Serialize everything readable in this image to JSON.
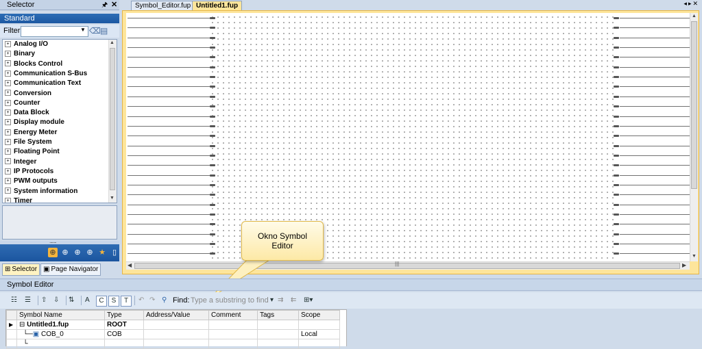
{
  "selector": {
    "title": "Selector",
    "category": "Standard",
    "filter_label": "Filter",
    "filter_value": "",
    "tree_items": [
      "Analog I/O",
      "Binary",
      "Blocks Control",
      "Communication S-Bus",
      "Communication Text",
      "Conversion",
      "Counter",
      "Data Block",
      "Display module",
      "Energy Meter",
      "File System",
      "Floating Point",
      "Integer",
      "IP Protocols",
      "PWM outputs",
      "System information",
      "Timer"
    ],
    "bottom_tabs": [
      "Selector",
      "Page Navigator"
    ]
  },
  "doc_tabs": [
    "Symbol_Editor.fup",
    "Untitled1.fup"
  ],
  "callout": {
    "line1": "Okno Symbol",
    "line2": "Editor"
  },
  "symbol_editor": {
    "title": "Symbol Editor",
    "toolbar_letters": [
      "A",
      "C",
      "S",
      "T"
    ],
    "find_label": "Find:",
    "find_placeholder": "Type a substring to find",
    "columns": [
      "Symbol Name",
      "Type",
      "Address/Value",
      "Comment",
      "Tags",
      "Scope"
    ],
    "rows": [
      {
        "name": "Untitled1.fup",
        "type": "ROOT",
        "address": "",
        "comment": "",
        "tags": "",
        "scope": ""
      },
      {
        "name": "COB_0",
        "type": "COB",
        "address": "",
        "comment": "",
        "tags": "",
        "scope": "Local"
      }
    ]
  },
  "colors": {
    "accent_blue": "#1c58a2",
    "active_tab": "#fde59b",
    "frame_bg": "#cfdbea"
  }
}
